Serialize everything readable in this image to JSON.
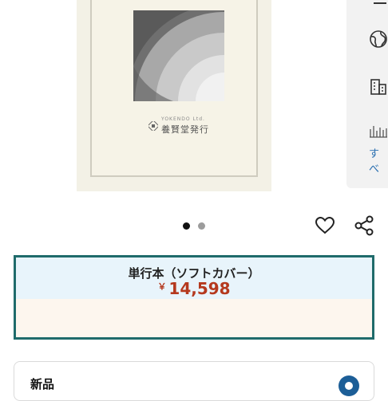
{
  "product": {
    "image": {
      "publisher_small": "YOKENDO Ltd.",
      "publisher_name": "養賢堂発行"
    },
    "carousel": {
      "current": 1,
      "total": 2
    }
  },
  "side_menu": {
    "more_label": "すべ"
  },
  "format": {
    "label": "単行本（ソフトカバー）",
    "currency": "￥",
    "price": "14,598"
  },
  "offer": {
    "condition_label": "新品"
  },
  "colors": {
    "accent_border": "#1f6b6b",
    "price": "#b5391e",
    "link": "#2a6fb0",
    "radio": "#1c5e97"
  }
}
